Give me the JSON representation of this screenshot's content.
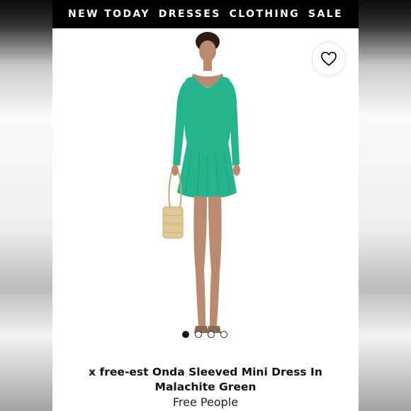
{
  "nav": {
    "items": [
      {
        "label": "NEW TODAY"
      },
      {
        "label": "DRESSES"
      },
      {
        "label": "CLOTHING"
      },
      {
        "label": "SALE"
      }
    ]
  },
  "product": {
    "title": "x free-est Onda Sleeved Mini Dress In Malachite Green",
    "brand": "Free People",
    "dress_color": "#25b48e",
    "wishlist_icon": "heart-icon",
    "gallery": {
      "image_count": 4,
      "active_index": 0
    }
  }
}
